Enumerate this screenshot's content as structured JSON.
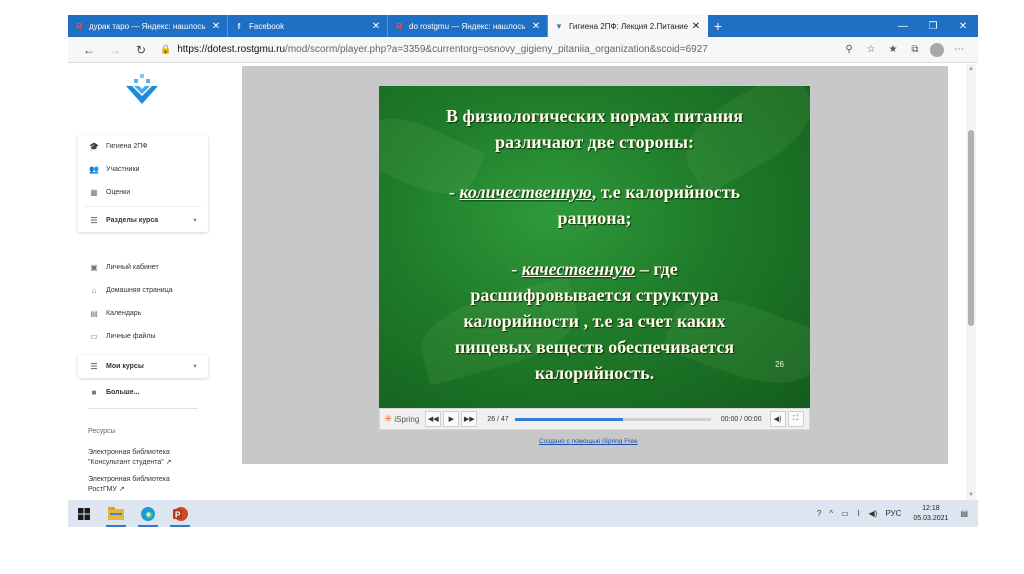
{
  "browser": {
    "tabs": [
      {
        "title": "дурак таро — Яндекс: нашлось",
        "icon": "yandex-icon",
        "active": false
      },
      {
        "title": "Facebook",
        "icon": "facebook-icon",
        "active": false
      },
      {
        "title": "do rostgmu — Яндекс: нашлось",
        "icon": "yandex-icon",
        "active": false
      },
      {
        "title": "Гигиена 2ПФ: Лекция 2.Питание",
        "icon": "moodle-icon",
        "active": true
      }
    ],
    "new_tab": "+",
    "controls": {
      "minimize": "—",
      "restore": "❐",
      "close": "✕"
    },
    "url_host": "https://dotest.rostgmu.ru",
    "url_path": "/mod/scorm/player.php?a=3359&currentorg=osnovy_gigieny_pitaniia_organization&scoid=6927"
  },
  "sidebar": {
    "course_card": [
      {
        "label": "Гигиена 2ПФ",
        "icon": "graduation-cap-icon"
      },
      {
        "label": "Участники",
        "icon": "users-icon"
      },
      {
        "label": "Оценки",
        "icon": "grades-icon"
      }
    ],
    "sections_label": "Разделы курса",
    "nav": [
      {
        "label": "Личный кабинет",
        "icon": "dashboard-icon"
      },
      {
        "label": "Домашняя страница",
        "icon": "home-icon"
      },
      {
        "label": "Календарь",
        "icon": "calendar-icon"
      },
      {
        "label": "Личные файлы",
        "icon": "files-icon"
      }
    ],
    "my_courses_label": "Мои курсы",
    "more_label": "Больше...",
    "resources_title": "Ресурсы",
    "links": [
      {
        "line1": "Электронная библиотека",
        "line2": "\"Консультант студента\""
      },
      {
        "line1": "Электронная библиотека",
        "line2": "РостГМУ"
      }
    ]
  },
  "slide": {
    "line1": "В физиологических нормах питания",
    "line2": "различают две стороны:",
    "line3_prefix": "- ",
    "line3_term": "количественную",
    "line3_rest": ", т.е калорийность",
    "line4": "рациона;",
    "line5_prefix": "- ",
    "line5_term": "качественную",
    "line5_rest": " – где",
    "line6": "расшифровывается структура",
    "line7": "калорийности , т.е за счет каких",
    "line8": "пищевых веществ обеспечивается",
    "line9": "калорийность.",
    "page_number": "26"
  },
  "player": {
    "brand": "iSpring",
    "slide_counter": "26 / 47",
    "progress_fraction": 0.55,
    "time": "00:00 / 00:00",
    "credit": "Создано с помощью iSpring Free"
  },
  "taskbar": {
    "apps": [
      "windows-start-icon",
      "file-explorer-icon",
      "edge-icon",
      "powerpoint-icon"
    ],
    "language": "РУС",
    "time": "12:18",
    "date": "05.03.2021"
  },
  "colors": {
    "tabbar": "#1f6fc4",
    "slide_green": "#1f7b2a",
    "slide_text": "#fffbe6",
    "progress": "#2f7fd6"
  }
}
